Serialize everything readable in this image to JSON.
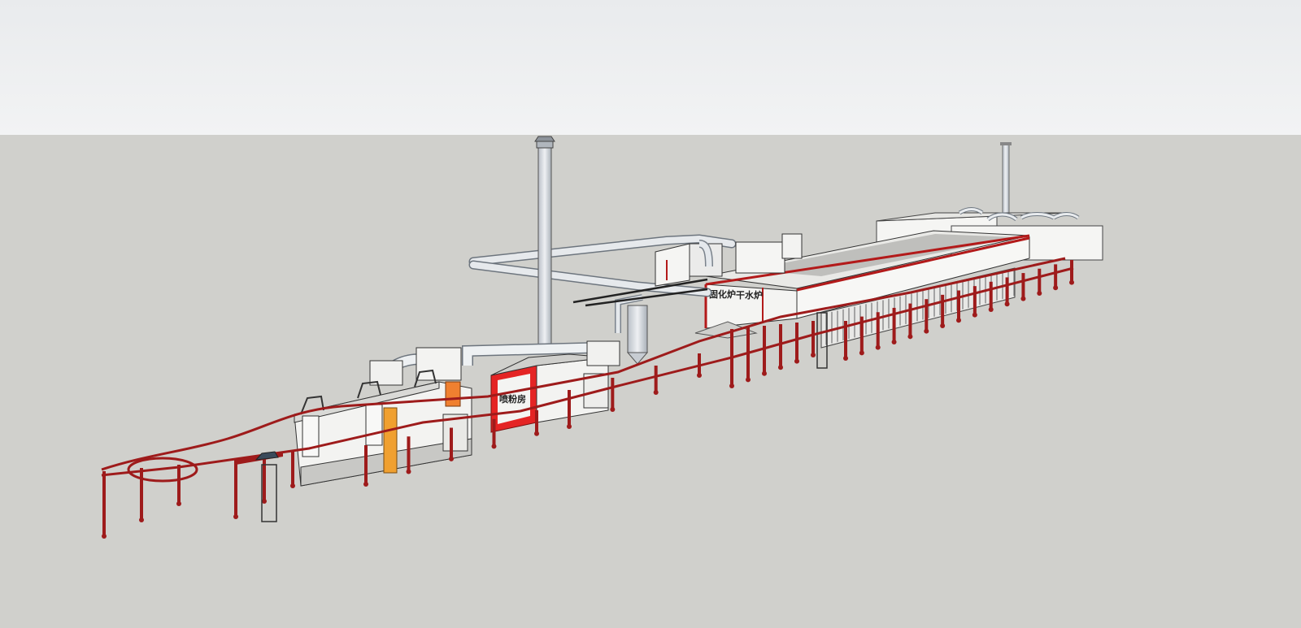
{
  "scene": {
    "colors": {
      "sky_top": "#e9ebed",
      "sky_bottom": "#f1f2f3",
      "ground": "#d0d0cc",
      "steel": "#9e1b1b",
      "steel_dark": "#6e1010",
      "panel": "#f2f2f0",
      "panel_shade": "#d6d6d3",
      "duct": "#e3e6ea",
      "accent_orange": "#f0a030",
      "accent_red": "#e02020"
    },
    "labels": {
      "curing_oven": "固化炉",
      "drying_oven": "干水炉",
      "red_unit": "喷粉房"
    }
  }
}
